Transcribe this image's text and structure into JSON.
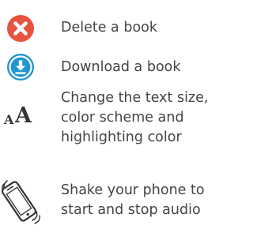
{
  "colors": {
    "text": "#444444",
    "delete_red": "#e8533f",
    "download_blue": "#2196d3",
    "dark_icon": "#333333"
  },
  "items": [
    {
      "icon": "delete-x-circle-icon",
      "lines": [
        "Delete a book"
      ]
    },
    {
      "icon": "download-arrow-circle-icon",
      "lines": [
        "Download a book"
      ]
    },
    {
      "icon": "text-size-aa-icon",
      "glyph_small": "A",
      "glyph_large": "A",
      "lines": [
        "Change the text size,",
        "color scheme and",
        "highlighting color"
      ]
    },
    {
      "icon": "shake-phone-icon",
      "lines": [
        "Shake your phone to",
        "start and stop audio"
      ]
    }
  ]
}
